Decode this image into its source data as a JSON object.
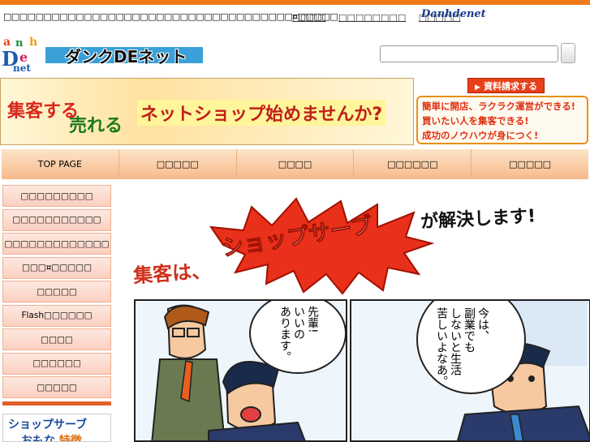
{
  "header": {
    "site_description": "□□□□□□□□□□□□□□□□□□□□□□□□□□□□□□□□□□□□¤□□□□□",
    "top_links": [
      "□□□□",
      "□□□□□□□□",
      "□□□□□"
    ],
    "brand_small": "Danhdenet",
    "logo_letters": [
      "a",
      "n",
      "h",
      "D",
      "e",
      "net"
    ],
    "logo_title": "ダンクDEネット",
    "search_placeholder": ""
  },
  "banner": {
    "text_1": "集客する",
    "text_2": "売れる",
    "main_text": "ネットショップ始めませんか?",
    "request_button": "資料請求する",
    "features": [
      "簡単に開店、ラクラク運営ができる!",
      "買いたい人を集客できる!",
      "成功のノウハウが身につく!"
    ]
  },
  "nav": {
    "items": [
      "TOP PAGE",
      "□□□□□",
      "□□□□",
      "□□□□□□",
      "□□□□□"
    ]
  },
  "sidebar": {
    "items": [
      "□□□□□□□□□",
      "□□□□□□□□□□□",
      "□□□□□□□□□□□□□",
      "□□□¤□□□□□",
      "□□□□□",
      "Flash□□□□□□",
      "□□□□",
      "□□□□□□",
      "□□□□□"
    ],
    "promo_line1": "ショップサーブ",
    "promo_line2_a": "おもな",
    "promo_line2_b": "特徴"
  },
  "headline": {
    "left": "集客は、",
    "center": "ショップサーブ",
    "right": "が解決します!"
  },
  "comic": {
    "panel1_bubble": [
      "先輩!",
      "いいの",
      "あります。"
    ],
    "panel2_bubble": [
      "今は、",
      "副業でも",
      "しないと生活",
      "苦しいよなあ。"
    ]
  },
  "colors": {
    "accent_orange": "#f07a1a",
    "nav_gradient_top": "#fde4c8",
    "nav_gradient_bottom": "#f7b98a",
    "sidebar_bg": "#fbd0c0",
    "burst_red": "#e8301a"
  }
}
